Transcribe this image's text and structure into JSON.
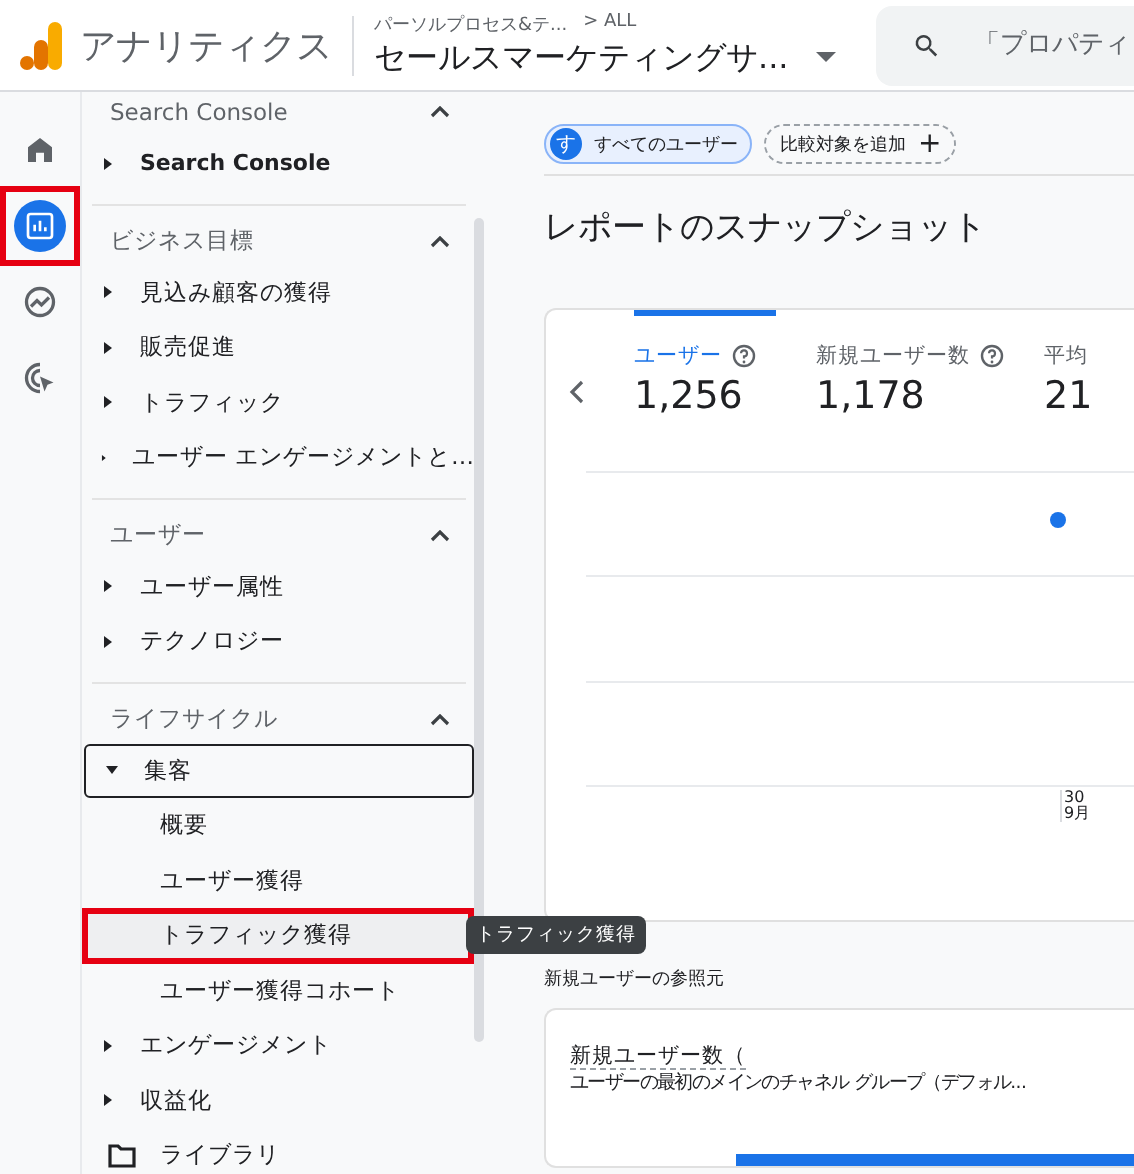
{
  "header": {
    "product": "アナリティクス",
    "account": "パーソルプロセス&テ...",
    "account_sub": "> ALL",
    "property": "セールスマーケティングサ...",
    "search_placeholder": "「プロパティ"
  },
  "rail": [
    {
      "kind": "home",
      "selected": false,
      "highlighted": false
    },
    {
      "kind": "reports",
      "selected": true,
      "highlighted": true
    },
    {
      "kind": "explore",
      "selected": false,
      "highlighted": false
    },
    {
      "kind": "advertising",
      "selected": false,
      "highlighted": false
    }
  ],
  "nav": [
    {
      "title": "Search Console",
      "expanded": true,
      "items": [
        {
          "label": "Search Console",
          "expanded": false,
          "focused": false
        }
      ]
    },
    {
      "title": "ビジネス目標",
      "expanded": true,
      "items": [
        {
          "label": "見込み顧客の獲得",
          "expanded": false,
          "focused": false
        },
        {
          "label": "販売促進",
          "expanded": false,
          "focused": false
        },
        {
          "label": "トラフィック",
          "expanded": false,
          "focused": false
        },
        {
          "label": "ユーザー エンゲージメントと…",
          "expanded": false,
          "focused": false
        }
      ]
    },
    {
      "title": "ユーザー",
      "expanded": true,
      "items": [
        {
          "label": "ユーザー属性",
          "expanded": false,
          "focused": false
        },
        {
          "label": "テクノロジー",
          "expanded": false,
          "focused": false
        }
      ]
    },
    {
      "title": "ライフサイクル",
      "expanded": true,
      "items": [
        {
          "label": "集客",
          "expanded": true,
          "focused": true,
          "children": [
            {
              "label": "概要",
              "highlighted": false
            },
            {
              "label": "ユーザー獲得",
              "highlighted": false
            },
            {
              "label": "トラフィック獲得",
              "highlighted": true
            },
            {
              "label": "ユーザー獲得コホート",
              "highlighted": false
            }
          ]
        },
        {
          "label": "エンゲージメント",
          "expanded": false,
          "focused": false
        },
        {
          "label": "収益化",
          "expanded": false,
          "focused": false
        }
      ]
    }
  ],
  "library": "ライブラリ",
  "tooltip": "トラフィック獲得",
  "chips": {
    "segment_initial": "す",
    "segment": "すべてのユーザー",
    "add_comparison": "比較対象を追加",
    "add_symbol": "+"
  },
  "title": "レポートのスナップショット",
  "metrics": [
    {
      "label": "ユーザー",
      "value": "1,256",
      "selected": true,
      "help": true
    },
    {
      "label": "新規ユーザー数",
      "value": "1,178",
      "selected": false,
      "help": true
    },
    {
      "label": "平均",
      "value": "21",
      "selected": false,
      "help": false
    }
  ],
  "axis_label": {
    "day": "30",
    "month": "9月"
  },
  "sources": {
    "heading": "新規ユーザーの参照元",
    "metric": "新規ユーザー数（",
    "dimension": "ユーザーの最初のメインのチャネル グループ（デフォル..."
  }
}
